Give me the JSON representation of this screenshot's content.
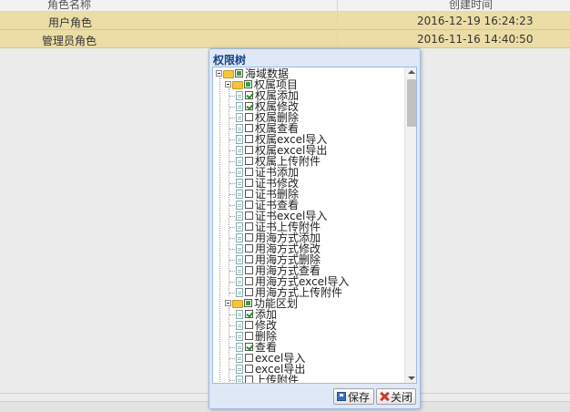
{
  "grid": {
    "columns": [
      "角色名称",
      "创建时间"
    ],
    "rows": [
      {
        "name": "用户角色",
        "created": "2016-12-19 16:24:23"
      },
      {
        "name": "管理员角色",
        "created": "2016-11-16 14:40:50"
      }
    ]
  },
  "dialog": {
    "title": "权限树",
    "tree": {
      "root": {
        "label": "海域数据",
        "state": "partial"
      },
      "groups": [
        {
          "label": "权属项目",
          "state": "partial",
          "items": [
            {
              "label": "权属添加",
              "checked": true
            },
            {
              "label": "权属修改",
              "checked": true
            },
            {
              "label": "权属删除",
              "checked": false
            },
            {
              "label": "权属查看",
              "checked": false
            },
            {
              "label": "权属excel导入",
              "checked": false
            },
            {
              "label": "权属excel导出",
              "checked": false
            },
            {
              "label": "权属上传附件",
              "checked": false
            },
            {
              "label": "证书添加",
              "checked": false
            },
            {
              "label": "证书修改",
              "checked": false
            },
            {
              "label": "证书删除",
              "checked": false
            },
            {
              "label": "证书查看",
              "checked": false
            },
            {
              "label": "证书excel导入",
              "checked": false
            },
            {
              "label": "证书上传附件",
              "checked": false
            },
            {
              "label": "用海方式添加",
              "checked": false
            },
            {
              "label": "用海方式修改",
              "checked": false
            },
            {
              "label": "用海方式删除",
              "checked": false
            },
            {
              "label": "用海方式查看",
              "checked": false
            },
            {
              "label": "用海方式excel导入",
              "checked": false
            },
            {
              "label": "用海方式上传附件",
              "checked": false
            }
          ]
        },
        {
          "label": "功能区划",
          "state": "partial",
          "items": [
            {
              "label": "添加",
              "checked": true
            },
            {
              "label": "修改",
              "checked": false
            },
            {
              "label": "删除",
              "checked": false
            },
            {
              "label": "查看",
              "checked": true
            },
            {
              "label": "excel导入",
              "checked": false
            },
            {
              "label": "excel导出",
              "checked": false
            },
            {
              "label": "上传附件",
              "checked": false
            }
          ]
        }
      ]
    },
    "buttons": {
      "save": "保存",
      "close": "关闭"
    }
  },
  "colors": {
    "row_selected": "#ebdda5",
    "dialog_bg": "#dfe8f6",
    "dialog_border": "#99bbe8",
    "title_color": "#15428b",
    "check_green": "#2a8a2a",
    "close_red": "#d23a2a"
  },
  "icons": [
    "expander-minus-icon",
    "folder-open-icon",
    "leaf-page-icon",
    "checkbox-icon",
    "save-icon",
    "close-icon",
    "scroll-up-icon",
    "scroll-down-icon"
  ]
}
